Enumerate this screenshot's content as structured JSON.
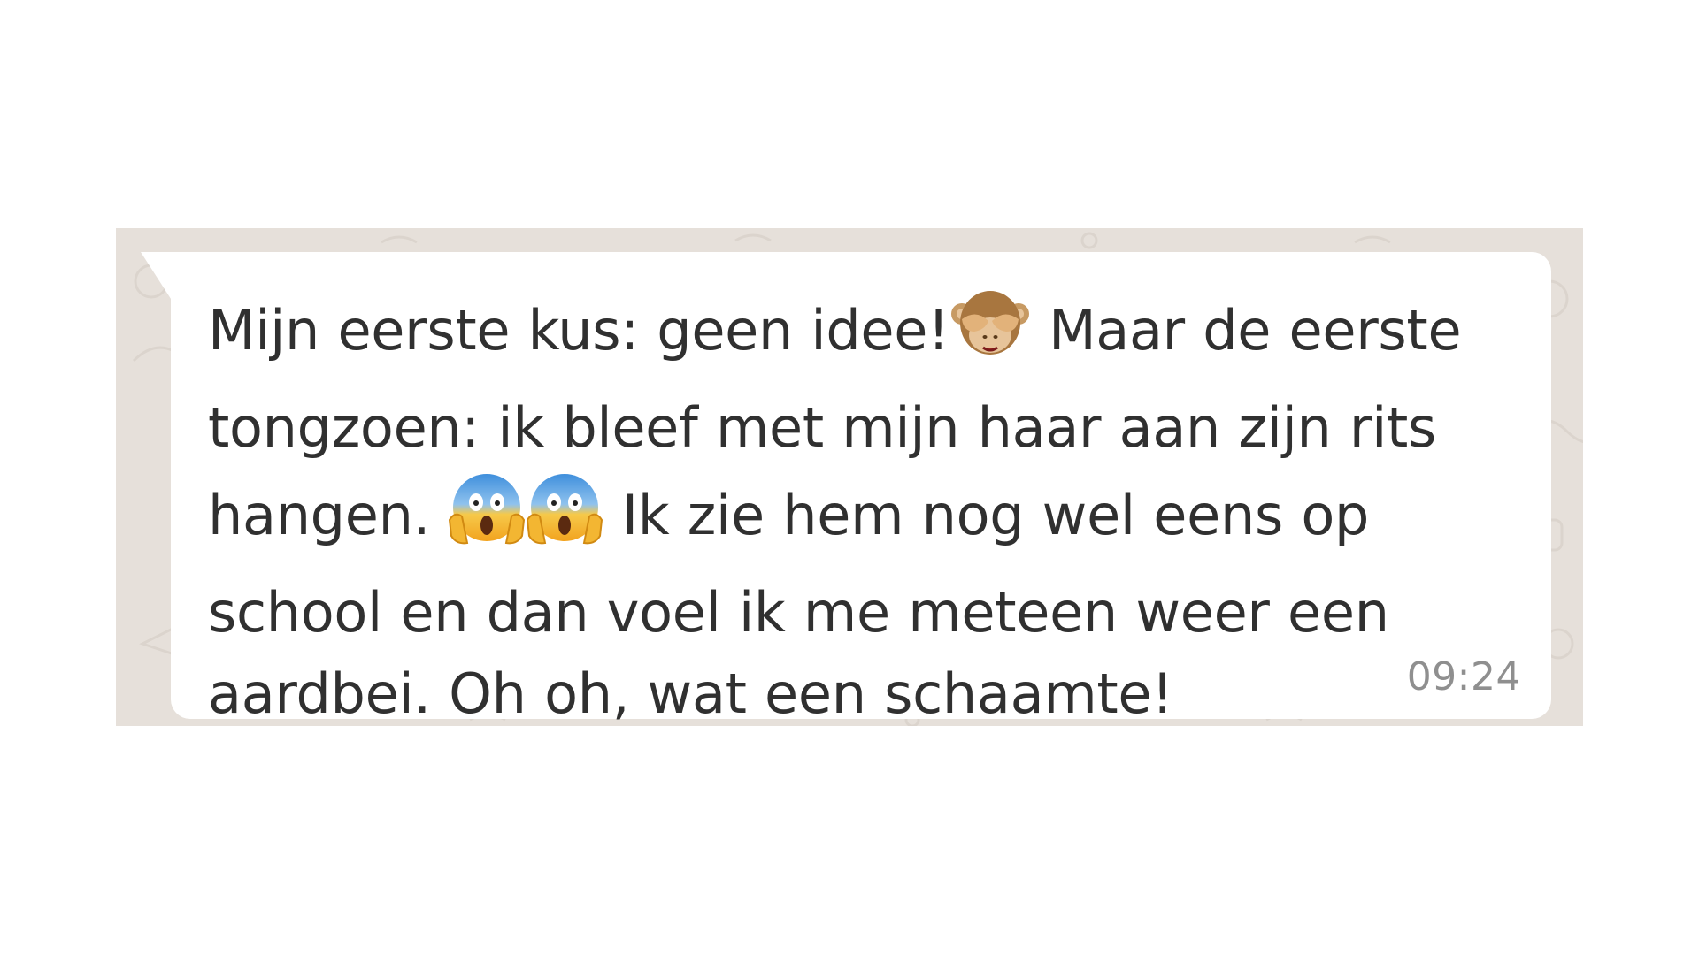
{
  "chat": {
    "background_color": "#e6e0da",
    "bubble_color": "#ffffff",
    "message": {
      "lines": [
        {
          "before": "Mijn eerste kus: geen idee!",
          "after": " Maar de eerste"
        },
        {
          "text": "tongzoen: ik bleef met mijn haar aan zijn rits"
        },
        {
          "before": "hangen. ",
          "after": " Ik zie hem nog wel eens op"
        },
        {
          "text": "school en dan voel ik me meteen weer een"
        },
        {
          "text": "aardbei. Oh oh, wat een schaamte!"
        }
      ],
      "emojis": [
        "see-no-evil-monkey-icon",
        "face-screaming-in-fear-icon",
        "face-screaming-in-fear-icon"
      ],
      "timestamp": "09:24"
    }
  }
}
